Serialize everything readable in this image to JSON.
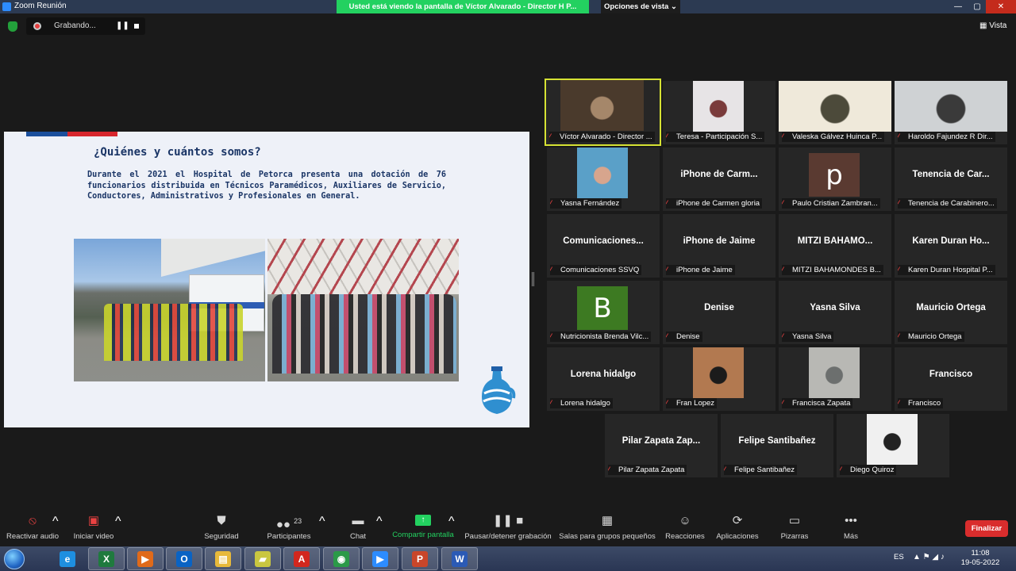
{
  "window": {
    "title": "Zoom Reunión",
    "share_banner": "Usted está viendo la pantalla de Víctor Alvarado - Director H P...",
    "view_options": "Opciones de vista",
    "view_options_icon": "chevron-down-icon",
    "min": "—",
    "max": "▢",
    "close": "✕"
  },
  "recording": {
    "label": "Grabando...",
    "pause_glyph": "❚❚",
    "view_label": "Vista"
  },
  "slide": {
    "title": "¿Quiénes y cuántos somos?",
    "body": "Durante el 2021 el Hospital de Petorca presenta una dotación de 76 funcionarios distribuida en Técnicos Paramédicos, Auxiliares de Servicio, Conductores, Administrativos y Profesionales en General."
  },
  "participants": [
    {
      "label": "Víctor Alvarado - Director ...",
      "big": "",
      "video": true,
      "active": true
    },
    {
      "label": "Teresa - Participación S...",
      "big": "",
      "video": true
    },
    {
      "label": "Valeska Gálvez Huinca P...",
      "big": "",
      "video": true
    },
    {
      "label": "Haroldo Fajundez R Dir...",
      "big": "",
      "video": true
    },
    {
      "label": "Yasna Fernández",
      "big": "",
      "video": true
    },
    {
      "label": "iPhone de Carmen gloria",
      "big": "iPhone de Carm..."
    },
    {
      "label": "Paulo Cristian Zambran...",
      "big": "",
      "avatar": "p",
      "avatar_color": "#5a3a31"
    },
    {
      "label": "Tenencia de Carabinero...",
      "big": "Tenencia de Car..."
    },
    {
      "label": "Comunicaciones SSVQ",
      "big": "Comunicaciones..."
    },
    {
      "label": "iPhone de Jaime",
      "big": "iPhone de Jaime"
    },
    {
      "label": "MITZI BAHAMONDES B...",
      "big": "MITZI BAHAMO..."
    },
    {
      "label": "Karen Duran Hospital P...",
      "big": "Karen Duran Ho..."
    },
    {
      "label": "Nutricionista Brenda Vilc...",
      "big": "",
      "avatar": "B",
      "avatar_color": "#3d7a22"
    },
    {
      "label": "Denise",
      "big": "Denise"
    },
    {
      "label": "Yasna Silva",
      "big": "Yasna Silva"
    },
    {
      "label": "Mauricio Ortega",
      "big": "Mauricio Ortega"
    },
    {
      "label": "Lorena hidalgo",
      "big": "Lorena hidalgo"
    },
    {
      "label": "Fran Lopez",
      "big": "",
      "video": true
    },
    {
      "label": "Francisca Zapata",
      "big": "",
      "video": true
    },
    {
      "label": "Francisco",
      "big": "Francisco"
    },
    {
      "label": "Pilar Zapata Zapata",
      "big": "Pilar Zapata Zap..."
    },
    {
      "label": "Felipe Santibañez",
      "big": "Felipe Santibañez"
    },
    {
      "label": "Diego Quiroz",
      "big": "",
      "video": true
    }
  ],
  "toolbar": {
    "unmute": "Reactivar audio",
    "start_video": "Iniciar video",
    "security": "Seguridad",
    "participants": "Participantes",
    "participants_count": "23",
    "chat": "Chat",
    "share": "Compartir pantalla",
    "pause_rec": "Pausar/detener grabación",
    "breakout": "Salas para grupos pequeños",
    "reactions": "Reacciones",
    "apps": "Aplicaciones",
    "whiteboards": "Pizarras",
    "more": "Más",
    "end": "Finalizar",
    "caret": "^"
  },
  "taskbar": {
    "apps": [
      {
        "name": "internet-explorer",
        "glyph": "e",
        "color": "#1e8fe0"
      },
      {
        "name": "excel",
        "glyph": "X",
        "color": "#1f7a3e"
      },
      {
        "name": "media-player",
        "glyph": "▶",
        "color": "#e06a1a"
      },
      {
        "name": "outlook",
        "glyph": "O",
        "color": "#0a63c4"
      },
      {
        "name": "file-explorer",
        "glyph": "▤",
        "color": "#e7b93b"
      },
      {
        "name": "sticky-notes",
        "glyph": "▰",
        "color": "#c9c640"
      },
      {
        "name": "acrobat",
        "glyph": "A",
        "color": "#d2271e"
      },
      {
        "name": "chrome",
        "glyph": "◉",
        "color": "#2b9a48"
      },
      {
        "name": "zoom",
        "glyph": "▶",
        "color": "#2d8cff"
      },
      {
        "name": "powerpoint",
        "glyph": "P",
        "color": "#c9462a"
      },
      {
        "name": "word",
        "glyph": "W",
        "color": "#2b5ab5"
      }
    ],
    "lang": "ES",
    "tray": "▲ ⚑ ◢ ♪",
    "time": "11:08",
    "date": "19-05-2022"
  }
}
